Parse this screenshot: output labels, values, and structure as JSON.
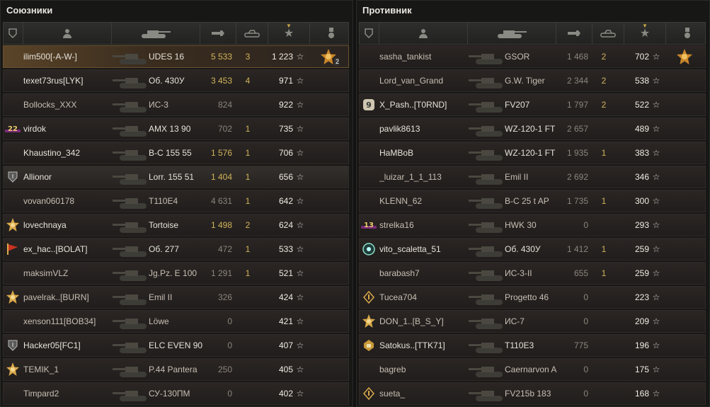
{
  "allies": {
    "title": "Союзники",
    "rows": [
      {
        "name": "ilim500[-A-W-]",
        "tank": "UDES 16",
        "damage": "5 533",
        "damage_gold": true,
        "kills": "3",
        "xp": "1 223",
        "badge": "",
        "medal": "medal-icon",
        "medal_count": "2",
        "highlight": "hl"
      },
      {
        "name": "texet73rus[LYK]",
        "tank": "Об. 430У",
        "damage": "3 453",
        "damage_gold": true,
        "kills": "4",
        "xp": "971",
        "badge": "",
        "medal": "",
        "highlight": ""
      },
      {
        "name": "Bollocks_XXX",
        "tank": "ИС-3",
        "damage": "824",
        "damage_gold": false,
        "kills": "",
        "xp": "922",
        "badge": "",
        "medal": "",
        "highlight": "",
        "dim": true
      },
      {
        "name": "virdok",
        "tank": "AMX 13 90",
        "damage": "702",
        "damage_gold": false,
        "kills": "1",
        "xp": "735",
        "badge": "22",
        "medal": "",
        "highlight": ""
      },
      {
        "name": "Khaustino_342",
        "tank": "B-C 155 55",
        "damage": "1 576",
        "damage_gold": true,
        "kills": "1",
        "xp": "706",
        "badge": "",
        "medal": "",
        "highlight": ""
      },
      {
        "name": "Allionor",
        "tank": "Lorr. 155 51",
        "damage": "1 404",
        "damage_gold": true,
        "kills": "1",
        "xp": "656",
        "badge": "I",
        "medal": "",
        "highlight": "self"
      },
      {
        "name": "vovan060178",
        "tank": "T110E4",
        "damage": "4 631",
        "damage_gold": false,
        "kills": "1",
        "xp": "642",
        "badge": "",
        "medal": "",
        "highlight": "",
        "dim": true
      },
      {
        "name": "lovechnaya",
        "tank": "Tortoise",
        "damage": "1 498",
        "damage_gold": true,
        "kills": "2",
        "xp": "624",
        "badge": "star",
        "medal": "",
        "highlight": ""
      },
      {
        "name": "ex_hac..[BOLAT]",
        "tank": "Об. 277",
        "damage": "472",
        "damage_gold": false,
        "kills": "1",
        "xp": "533",
        "badge": "flag",
        "medal": "",
        "highlight": ""
      },
      {
        "name": "maksimVLZ",
        "tank": "Jg.Pz. E 100",
        "damage": "1 291",
        "damage_gold": false,
        "kills": "1",
        "xp": "521",
        "badge": "",
        "medal": "",
        "highlight": "",
        "dim": true
      },
      {
        "name": "pavelrak..[BURN]",
        "tank": "Emil II",
        "damage": "326",
        "damage_gold": false,
        "kills": "",
        "xp": "424",
        "badge": "star",
        "medal": "",
        "highlight": "",
        "dim": true
      },
      {
        "name": "xenson111[BOB34]",
        "tank": "Löwe",
        "damage": "0",
        "damage_gold": false,
        "kills": "",
        "xp": "421",
        "badge": "",
        "medal": "",
        "highlight": "",
        "dim": true
      },
      {
        "name": "Hacker05[FC1]",
        "tank": "ELC EVEN 90",
        "damage": "0",
        "damage_gold": false,
        "kills": "",
        "xp": "407",
        "badge": "I",
        "medal": "",
        "highlight": ""
      },
      {
        "name": "TEMIK_1",
        "tank": "P.44 Pantera",
        "damage": "250",
        "damage_gold": false,
        "kills": "",
        "xp": "405",
        "badge": "star",
        "medal": "",
        "highlight": "",
        "dim": true
      },
      {
        "name": "Timpard2",
        "tank": "СУ-130ПМ",
        "damage": "0",
        "damage_gold": false,
        "kills": "",
        "xp": "402",
        "badge": "",
        "medal": "",
        "highlight": "",
        "dim": true
      }
    ]
  },
  "enemies": {
    "title": "Противник",
    "rows": [
      {
        "name": "sasha_tankist",
        "tank": "GSOR",
        "damage": "1 468",
        "damage_gold": false,
        "kills": "2",
        "xp": "702",
        "badge": "",
        "medal": "medal-icon",
        "medal_count": "",
        "highlight": "",
        "dim": true
      },
      {
        "name": "Lord_van_Grand",
        "tank": "G.W. Tiger",
        "damage": "2 344",
        "damage_gold": false,
        "kills": "2",
        "xp": "538",
        "badge": "",
        "medal": "",
        "highlight": "",
        "dim": true
      },
      {
        "name": "X_Pash..[T0RND]",
        "tank": "FV207",
        "damage": "1 797",
        "damage_gold": false,
        "kills": "2",
        "xp": "522",
        "badge": "9",
        "medal": "",
        "highlight": ""
      },
      {
        "name": "pavlik8613",
        "tank": "WZ-120-1 FT",
        "damage": "2 657",
        "damage_gold": false,
        "kills": "",
        "xp": "489",
        "badge": "",
        "medal": "",
        "highlight": ""
      },
      {
        "name": "HaMBoB",
        "tank": "WZ-120-1 FT",
        "damage": "1 935",
        "damage_gold": false,
        "kills": "1",
        "xp": "383",
        "badge": "",
        "medal": "",
        "highlight": ""
      },
      {
        "name": "_luizar_1_1_113",
        "tank": "Emil II",
        "damage": "2 692",
        "damage_gold": false,
        "kills": "",
        "xp": "346",
        "badge": "",
        "medal": "",
        "highlight": "",
        "dim": true
      },
      {
        "name": "KLENN_62",
        "tank": "B-C 25 t AP",
        "damage": "1 735",
        "damage_gold": false,
        "kills": "1",
        "xp": "300",
        "badge": "",
        "medal": "",
        "highlight": "",
        "dim": true
      },
      {
        "name": "strelka16",
        "tank": "HWK 30",
        "damage": "0",
        "damage_gold": false,
        "kills": "",
        "xp": "293",
        "badge": "13",
        "medal": "",
        "highlight": "",
        "dim": true
      },
      {
        "name": "vito_scaletta_51",
        "tank": "Об. 430У",
        "damage": "1 412",
        "damage_gold": false,
        "kills": "1",
        "xp": "259",
        "badge": "gear",
        "medal": "",
        "highlight": ""
      },
      {
        "name": "barabash7",
        "tank": "ИС-3-II",
        "damage": "655",
        "damage_gold": false,
        "kills": "1",
        "xp": "259",
        "badge": "",
        "medal": "",
        "highlight": "",
        "dim": true
      },
      {
        "name": "Tucea704",
        "tank": "Progetto 46",
        "damage": "0",
        "damage_gold": false,
        "kills": "",
        "xp": "223",
        "badge": "diamond",
        "medal": "",
        "highlight": "",
        "dim": true
      },
      {
        "name": "DON_1..[B_S_Y]",
        "tank": "ИС-7",
        "damage": "0",
        "damage_gold": false,
        "kills": "",
        "xp": "209",
        "badge": "star",
        "medal": "",
        "highlight": "",
        "dim": true
      },
      {
        "name": "Satokus..[TTK71]",
        "tank": "T110E3",
        "damage": "775",
        "damage_gold": false,
        "kills": "",
        "xp": "196",
        "badge": "crest",
        "medal": "",
        "highlight": ""
      },
      {
        "name": "bagreb",
        "tank": "Caernarvon A",
        "damage": "0",
        "damage_gold": false,
        "kills": "",
        "xp": "175",
        "badge": "",
        "medal": "",
        "highlight": "",
        "dim": true
      },
      {
        "name": "sueta_",
        "tank": "FV215b 183",
        "damage": "0",
        "damage_gold": false,
        "kills": "",
        "xp": "168",
        "badge": "diamond",
        "medal": "",
        "highlight": "",
        "dim": true
      }
    ]
  },
  "colors": {
    "gold": "#d1b45a",
    "text": "#e6e2d8",
    "dim": "#8a857c",
    "bg": "#171716"
  }
}
